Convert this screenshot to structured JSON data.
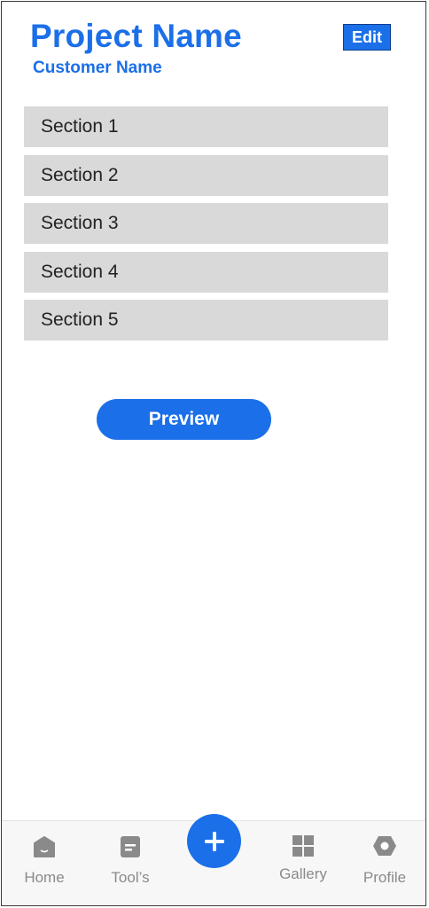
{
  "header": {
    "title": "Project Name",
    "subtitle": "Customer Name",
    "edit_label": "Edit"
  },
  "sections": [
    {
      "label": "Section 1"
    },
    {
      "label": "Section 2"
    },
    {
      "label": "Section 3"
    },
    {
      "label": "Section 4"
    },
    {
      "label": "Section 5"
    }
  ],
  "preview_label": "Preview",
  "nav": {
    "items": [
      {
        "label": "Home",
        "icon": "home-icon"
      },
      {
        "label": "Tool’s",
        "icon": "tools-icon"
      },
      {
        "label": "Gallery",
        "icon": "gallery-icon"
      },
      {
        "label": "Profile",
        "icon": "profile-icon"
      }
    ],
    "fab_icon": "plus-icon"
  },
  "colors": {
    "accent": "#1b6fe8",
    "section_bg": "#d9d9d9",
    "nav_icon": "#8a8a8a"
  }
}
